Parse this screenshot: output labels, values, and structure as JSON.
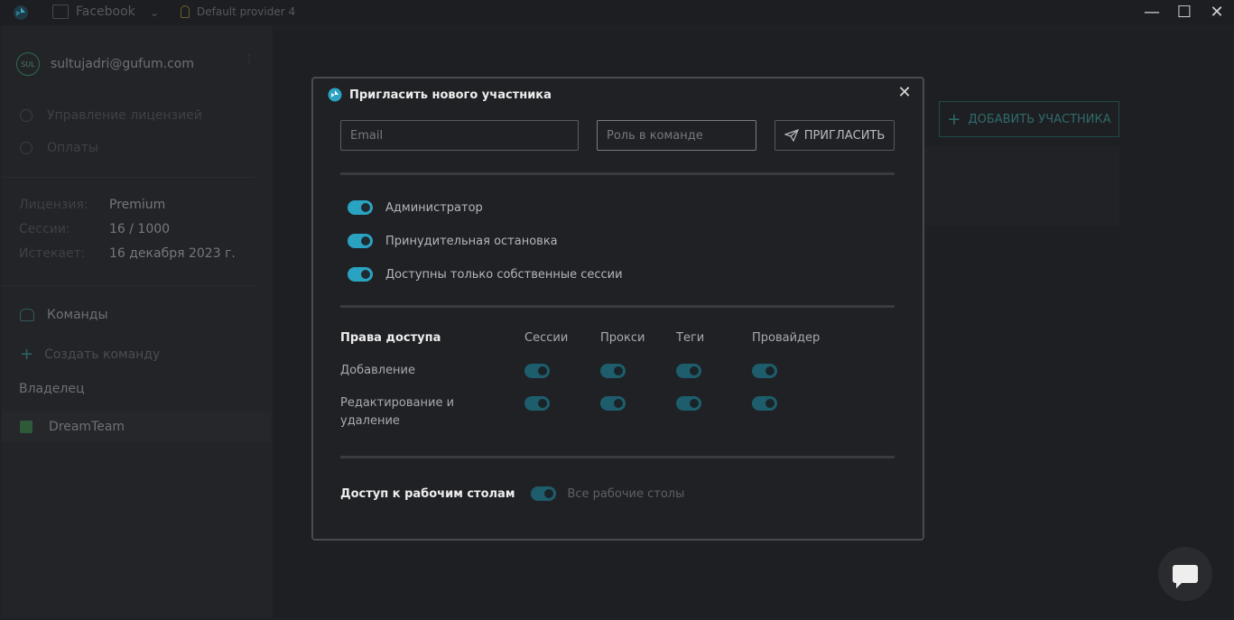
{
  "titlebar": {
    "profile": "Facebook",
    "provider": "Default provider 4",
    "controls": [
      "—",
      "☐",
      "✕"
    ]
  },
  "sidebar": {
    "avatar": "SUL",
    "email": "sultujadri@gufum.com",
    "links": [
      "Управление лицензией",
      "Оплаты"
    ],
    "license": [
      {
        "key": "Лицензия:",
        "value": "Premium"
      },
      {
        "key": "Сессии:",
        "value": "16 / 1000"
      },
      {
        "key": "Истекает:",
        "value": "16 декабря 2023 г."
      }
    ],
    "teams_label": "Команды",
    "create_team": "Создать команду",
    "owner_label": "Владелец",
    "team_name": "DreamTeam"
  },
  "main": {
    "add_member": "ДОБАВИТЬ УЧАСТНИКА"
  },
  "modal": {
    "title": "Пригласить нового участника",
    "email_placeholder": "Email",
    "role_placeholder": "Роль в команде",
    "invite_label": "ПРИГЛАСИТЬ",
    "options": [
      {
        "label": "Администратор",
        "on": true
      },
      {
        "label": "Принудительная остановка",
        "on": true
      },
      {
        "label": "Доступны только собственные сессии",
        "on": true
      }
    ],
    "rights": {
      "title": "Права доступа",
      "columns": [
        "Сессии",
        "Прокси",
        "Теги",
        "Провайдер"
      ],
      "rows": [
        {
          "label": "Добавление",
          "values": [
            true,
            true,
            true,
            true
          ]
        },
        {
          "label": "Редактирование и удаление",
          "values": [
            true,
            true,
            true,
            true
          ]
        }
      ]
    },
    "desktops": {
      "label": "Доступ к рабочим столам",
      "toggle_label": "Все рабочие столы"
    }
  },
  "colors": {
    "accent": "#2aa3c2",
    "modal_bg": "#202125",
    "border": "#4a4b4f"
  }
}
